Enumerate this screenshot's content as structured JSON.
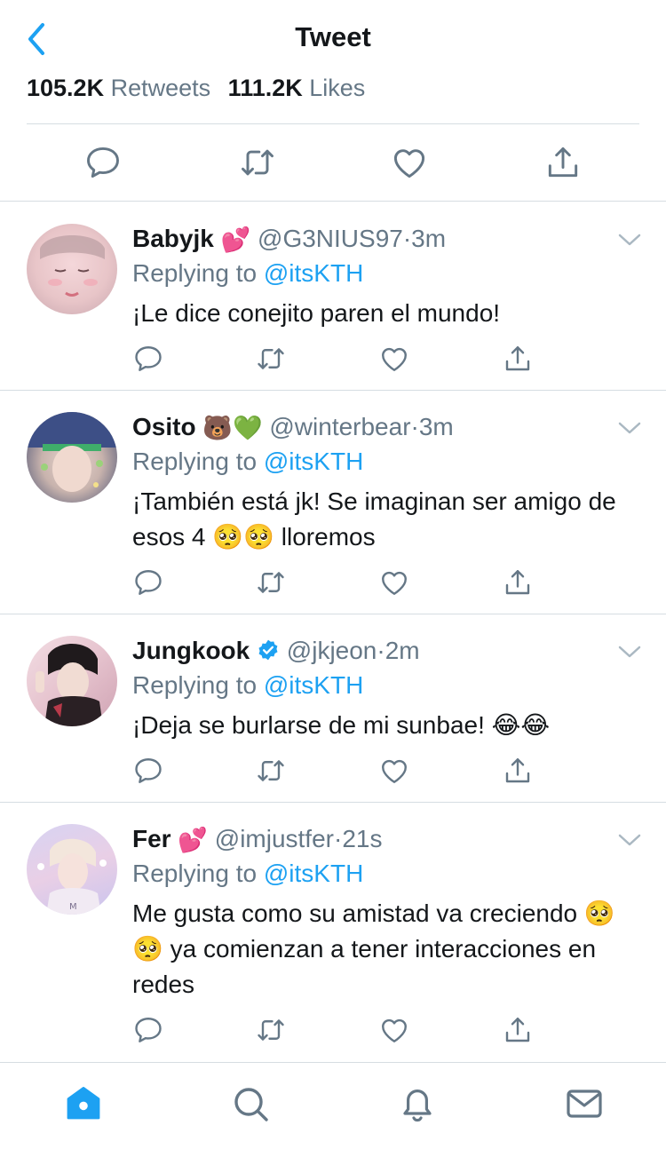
{
  "header": {
    "title": "Tweet",
    "back_icon": "chevron-left-icon"
  },
  "stats": {
    "retweets_count": "105.2K",
    "retweets_label": "Retweets",
    "likes_count": "111.2K",
    "likes_label": "Likes"
  },
  "main_actions": [
    "reply-icon",
    "retweet-icon",
    "like-icon",
    "share-icon"
  ],
  "replies": [
    {
      "name": "Babyjk",
      "emoji": "💕",
      "handle": "@G3NIUS97",
      "separator": "·",
      "time": "3m",
      "replying_prefix": "Replying to",
      "replying_to": "@itsKTH",
      "text": "¡Le dice conejito paren el mundo!"
    },
    {
      "name": "Osito",
      "emoji": "🐻💚",
      "handle": "@winterbear",
      "separator": "·",
      "time": "3m",
      "replying_prefix": "Replying to",
      "replying_to": "@itsKTH",
      "text": "¡También está jk! Se imaginan ser amigo de esos 4 🥺🥺 lloremos"
    },
    {
      "name": "Jungkook",
      "emoji": "",
      "verified": true,
      "handle": "@jkjeon",
      "separator": "·",
      "time": "2m",
      "replying_prefix": "Replying to",
      "replying_to": "@itsKTH",
      "text": "¡Deja se burlarse de mi sunbae! 😂😂"
    },
    {
      "name": "Fer",
      "emoji": "💕",
      "handle": "@imjustfer",
      "separator": "·",
      "time": "21s",
      "replying_prefix": "Replying to",
      "replying_to": "@itsKTH",
      "text": "Me gusta como su amistad va creciendo 🥺🥺 ya comienzan a tener interacciones en redes"
    }
  ],
  "tabbar": [
    "home-icon",
    "search-icon",
    "notifications-icon",
    "messages-icon"
  ],
  "colors": {
    "accent": "#1da1f2",
    "secondary_text": "#657786",
    "divider": "#d6dde2",
    "verified": "#1da1f2"
  }
}
